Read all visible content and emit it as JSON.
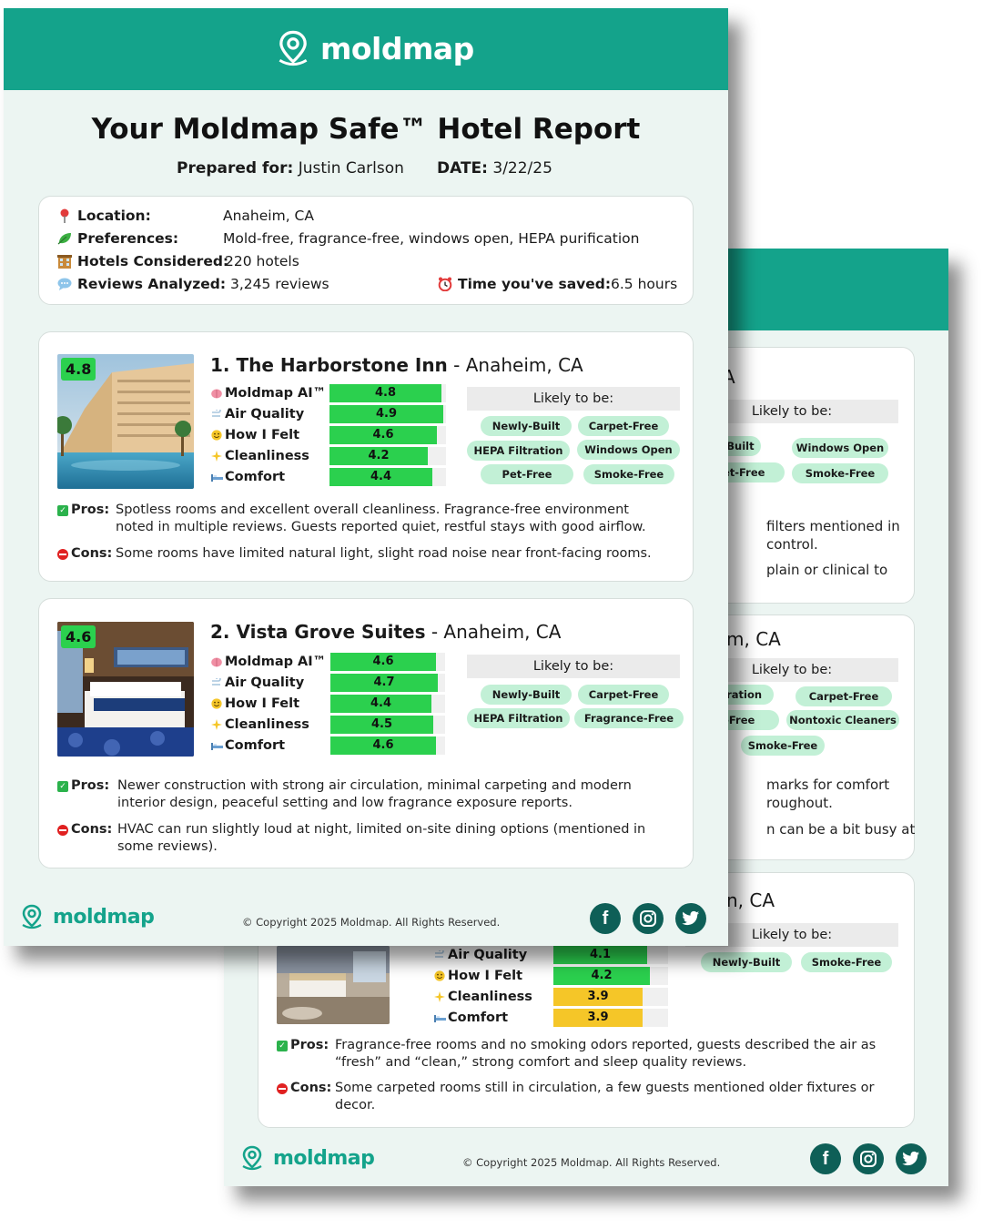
{
  "brand": {
    "name": "moldmap",
    "teal": "#14a38b",
    "green": "#2bd04e",
    "yellow": "#f5c628"
  },
  "report": {
    "title": "Your Moldmap Safe™ Hotel Report",
    "prepared_label": "Prepared for:",
    "prepared_value": "Justin Carlson",
    "date_label": "DATE:",
    "date_value": "3/22/25"
  },
  "summary": {
    "location_label": "Location:",
    "location_value": "Anaheim, CA",
    "preferences_label": "Preferences:",
    "preferences_value": "Mold-free, fragrance-free, windows open, HEPA purification",
    "hotels_label": "Hotels Considered:",
    "hotels_value": "220 hotels",
    "reviews_label": "Reviews Analyzed:",
    "reviews_value": "3,245 reviews",
    "time_label": "Time you've saved:",
    "time_value": "6.5 hours"
  },
  "likely_label": "Likely to be:",
  "metric_labels": [
    "Moldmap AI™",
    "Air Quality",
    "How I Felt",
    "Cleanliness",
    "Comfort"
  ],
  "pros_label": "Pros:",
  "cons_label": "Cons:",
  "hotels": [
    {
      "score": "4.8",
      "name": "1. The Harborstone Inn",
      "location": " - Anaheim, CA",
      "metrics": [
        {
          "label": "Moldmap AI™",
          "value": 4.8,
          "text": "4.8"
        },
        {
          "label": "Air Quality",
          "value": 4.9,
          "text": "4.9"
        },
        {
          "label": "How I Felt",
          "value": 4.6,
          "text": "4.6"
        },
        {
          "label": "Cleanliness",
          "value": 4.2,
          "text": "4.2"
        },
        {
          "label": "Comfort",
          "value": 4.4,
          "text": "4.4"
        }
      ],
      "tags": [
        "Newly-Built",
        "Carpet-Free",
        "HEPA Filtration",
        "Windows Open",
        "Pet-Free",
        "Smoke-Free"
      ],
      "pros_1": "Spotless rooms and excellent overall cleanliness. Fragrance-free environment",
      "pros_2": "noted in multiple reviews. Guests reported quiet, restful stays with good airflow.",
      "cons_1": "Some rooms have limited natural light, slight road noise near front-facing rooms."
    },
    {
      "score": "4.6",
      "name": "2. Vista Grove Suites",
      "location": " - Anaheim, CA",
      "metrics": [
        {
          "label": "Moldmap AI™",
          "value": 4.6,
          "text": "4.6"
        },
        {
          "label": "Air Quality",
          "value": 4.7,
          "text": "4.7"
        },
        {
          "label": "How I Felt",
          "value": 4.4,
          "text": "4.4"
        },
        {
          "label": "Cleanliness",
          "value": 4.5,
          "text": "4.5"
        },
        {
          "label": "Comfort",
          "value": 4.6,
          "text": "4.6"
        }
      ],
      "tags": [
        "Newly-Built",
        "Carpet-Free",
        "HEPA Filtration",
        "Fragrance-Free"
      ],
      "pros_1": "Newer construction with strong air circulation, minimal carpeting and modern",
      "pros_2": "interior design, peaceful setting and low fragrance exposure reports.",
      "cons_1": "HVAC can run slightly loud at night, limited on-site dining options (mentioned in",
      "cons_2": "some reviews)."
    }
  ],
  "back": {
    "card1_loc": "A",
    "card1_tags": [
      "wly-Built",
      "Windows Open",
      "Pet-Free",
      "Smoke-Free"
    ],
    "card1_pros_1": "filters mentioned in",
    "card1_pros_2": "control.",
    "card1_cons_1": "plain or clinical to",
    "card2_loc": "m, CA",
    "card2_tags": [
      "Filtration",
      "Carpet-Free",
      "t-Free",
      "Nontoxic Cleaners",
      "Smoke-Free"
    ],
    "card2_pros_1": "marks for comfort",
    "card2_pros_2": "roughout.",
    "card2_cons_1": "n can be a bit busy at",
    "card3_loc": "n, CA",
    "card3_tags": [
      "Newly-Built",
      "Smoke-Free"
    ],
    "card3_metrics": [
      {
        "label": "Air Quality",
        "value": 4.1,
        "text": "4.1",
        "color": "#2bd04e"
      },
      {
        "label": "How I Felt",
        "value": 4.2,
        "text": "4.2",
        "color": "#2bd04e"
      },
      {
        "label": "Cleanliness",
        "value": 3.9,
        "text": "3.9",
        "color": "#f5c628"
      },
      {
        "label": "Comfort",
        "value": 3.9,
        "text": "3.9",
        "color": "#f5c628"
      }
    ],
    "card3_pros_1": "Fragrance-free rooms and no smoking odors reported, guests described the air as",
    "card3_pros_2": "“fresh” and “clean,” strong comfort and sleep quality reviews.",
    "card3_cons_1": "Some carpeted rooms still in circulation, a few guests mentioned older fixtures or",
    "card3_cons_2": "decor."
  },
  "footer": {
    "copyright": "© Copyright 2025 Moldmap. All Rights Reserved."
  },
  "icons": {
    "location": "pin-icon",
    "preferences": "leaf-icon",
    "hotels": "hotel-icon",
    "reviews": "speech-bubble-icon",
    "time": "alarm-clock-icon",
    "social": [
      "facebook-icon",
      "instagram-icon",
      "twitter-icon"
    ]
  }
}
